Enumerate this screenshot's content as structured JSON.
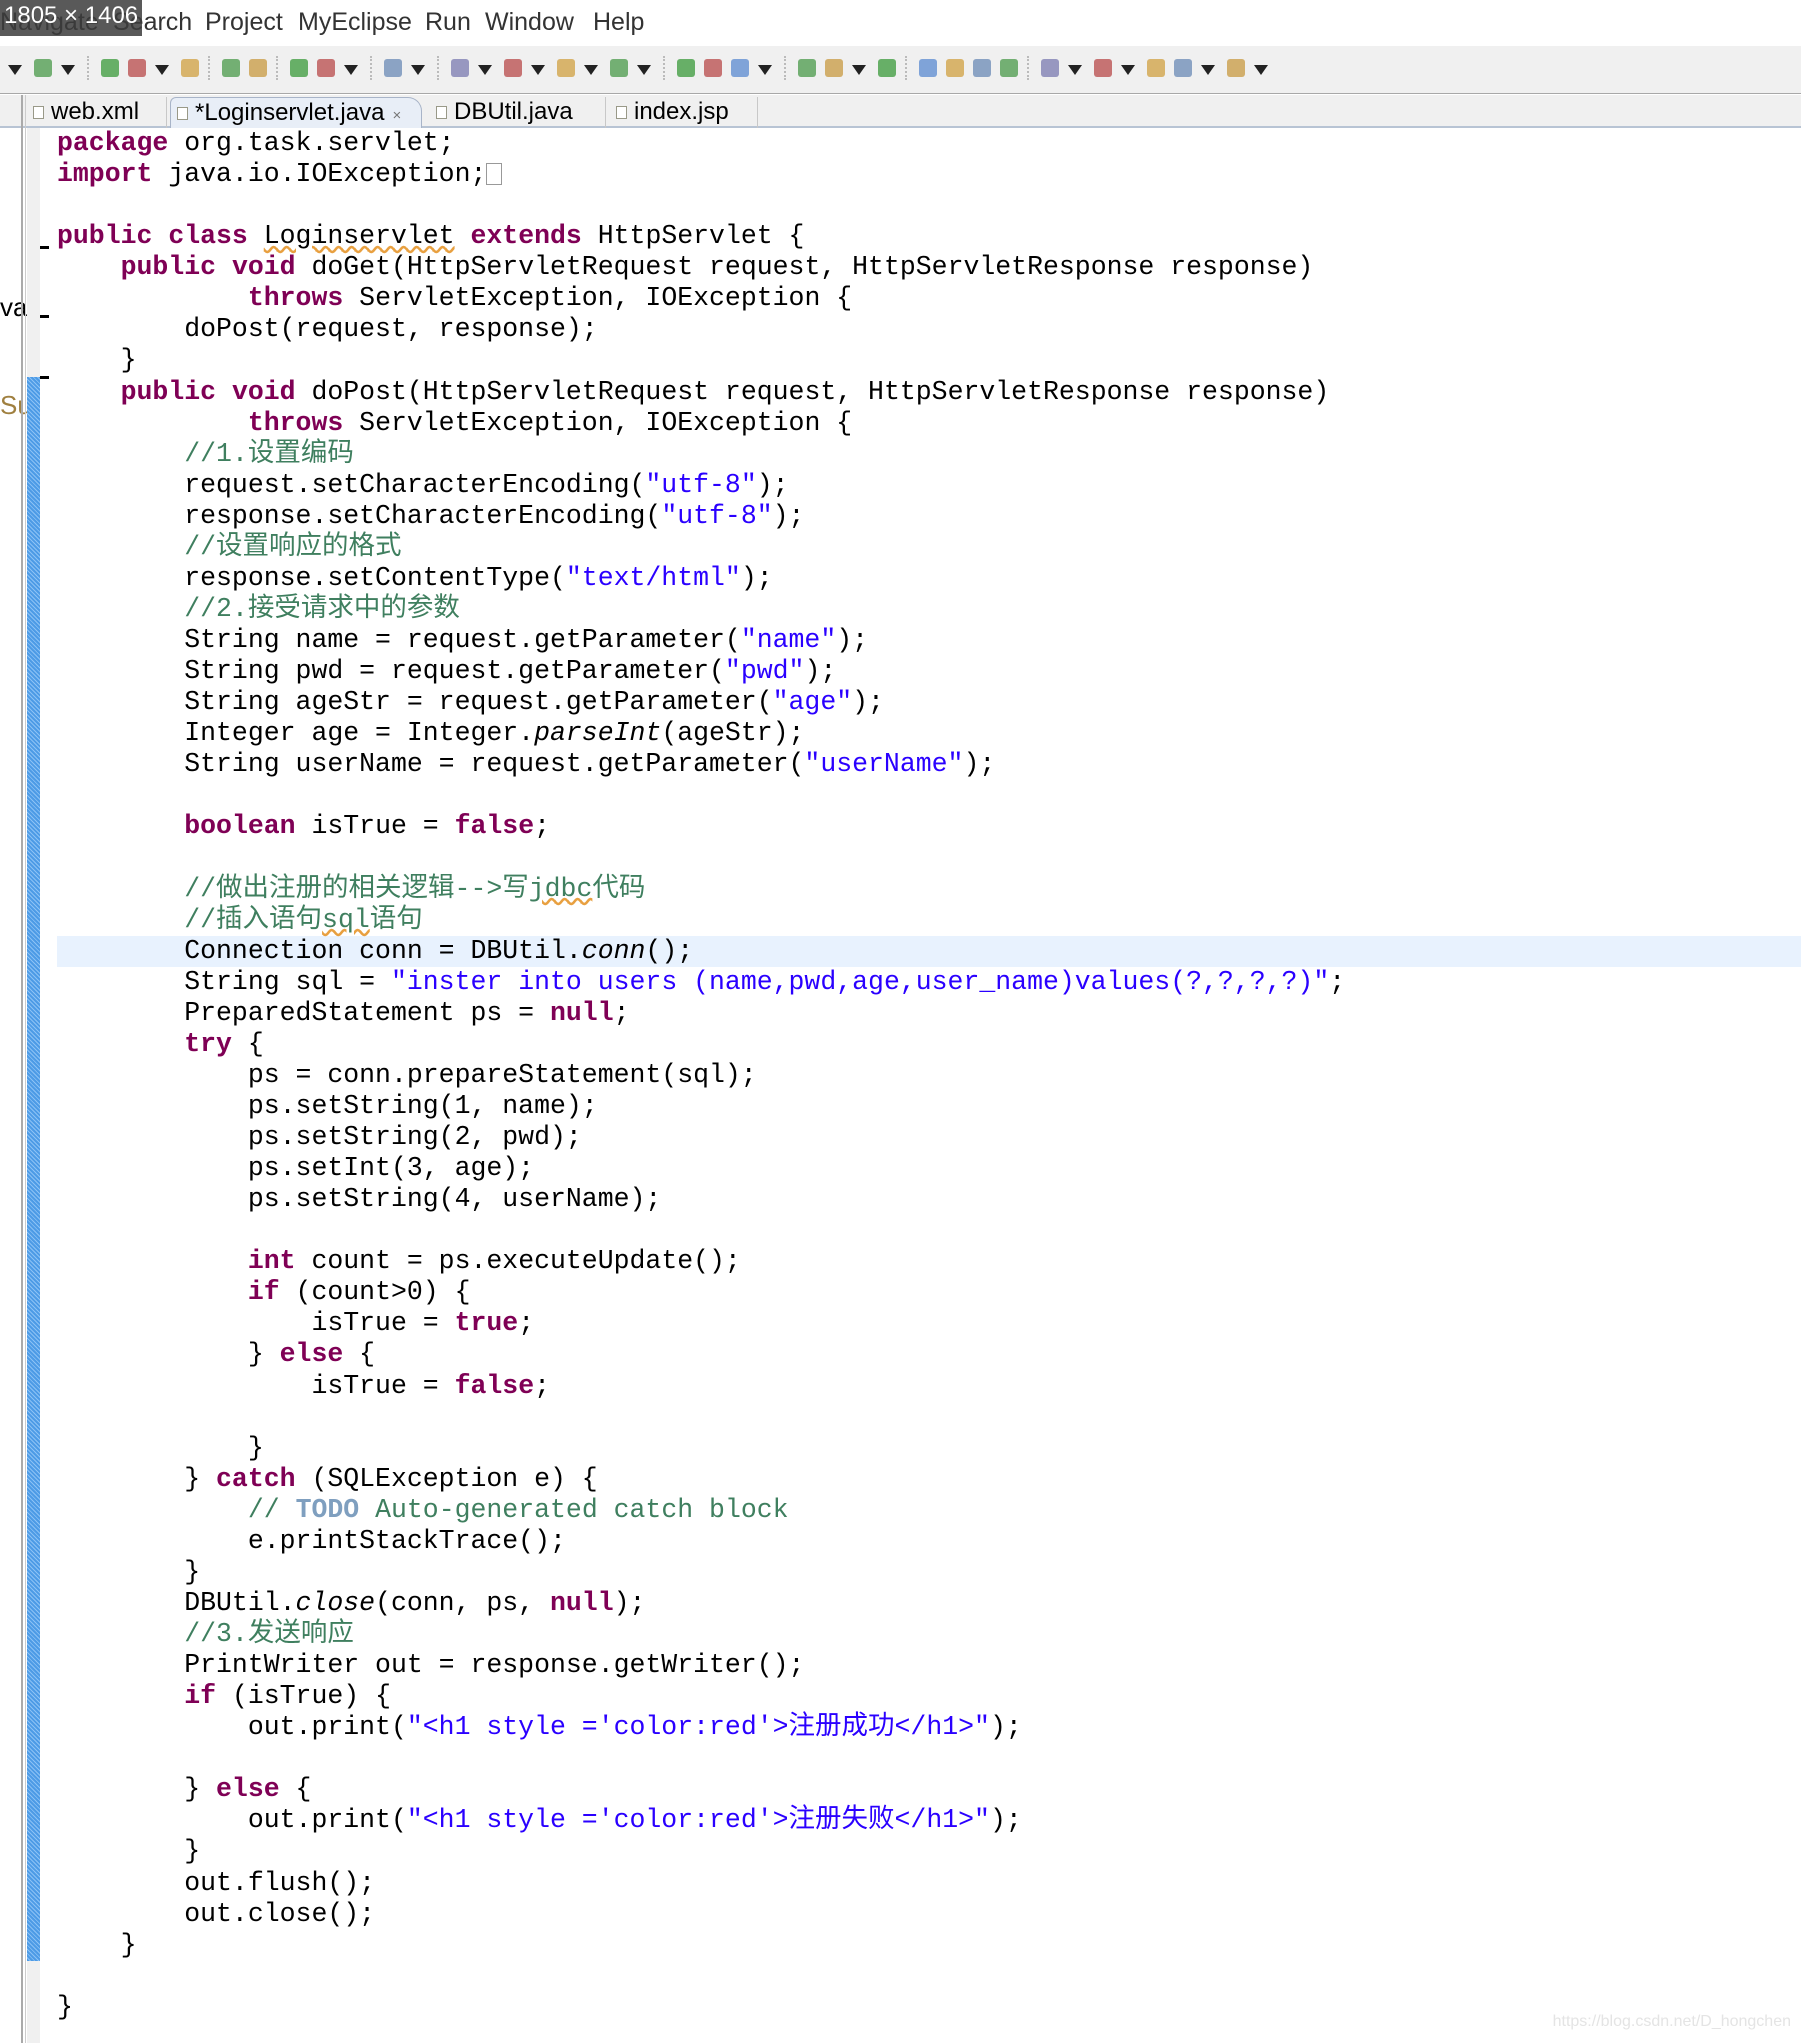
{
  "overlay": {
    "dimensions": "1805 × 1406"
  },
  "menu": [
    "Navigate",
    "Search",
    "Project",
    "MyEclipse",
    "Run",
    "Window",
    "Help"
  ],
  "tabs": [
    {
      "label": "web.xml",
      "active": false
    },
    {
      "label": "*Loginservlet.java",
      "active": true,
      "close": "×"
    },
    {
      "label": "DBUtil.java",
      "active": false
    },
    {
      "label": "index.jsp",
      "active": false
    }
  ],
  "side_fragments": [
    "va",
    "Su"
  ],
  "current_line": 26,
  "code": [
    [
      [
        "k",
        "package"
      ],
      [
        "p",
        " org.task.servlet;"
      ]
    ],
    [
      [
        "k",
        "import"
      ],
      [
        "p",
        " java.io.IOException;"
      ],
      [
        "box",
        ""
      ]
    ],
    [],
    [
      [
        "k",
        "public class"
      ],
      [
        "p",
        " "
      ],
      [
        "w",
        "Loginservlet"
      ],
      [
        "p",
        " "
      ],
      [
        "k",
        "extends"
      ],
      [
        "p",
        " HttpServlet {"
      ]
    ],
    [
      [
        "p",
        "    "
      ],
      [
        "k",
        "public void"
      ],
      [
        "p",
        " doGet(HttpServletRequest request, HttpServletResponse response)"
      ]
    ],
    [
      [
        "p",
        "            "
      ],
      [
        "k",
        "throws"
      ],
      [
        "p",
        " ServletException, IOException {"
      ]
    ],
    [
      [
        "p",
        "        doPost(request, response);"
      ]
    ],
    [
      [
        "p",
        "    }"
      ]
    ],
    [
      [
        "p",
        "    "
      ],
      [
        "k",
        "public void"
      ],
      [
        "p",
        " doPost(HttpServletRequest request, HttpServletResponse response)"
      ]
    ],
    [
      [
        "p",
        "            "
      ],
      [
        "k",
        "throws"
      ],
      [
        "p",
        " ServletException, IOException {"
      ]
    ],
    [
      [
        "p",
        "        "
      ],
      [
        "c",
        "//1.设置编码"
      ]
    ],
    [
      [
        "p",
        "        request.setCharacterEncoding("
      ],
      [
        "s",
        "\"utf-8\""
      ],
      [
        "p",
        ");"
      ]
    ],
    [
      [
        "p",
        "        response.setCharacterEncoding("
      ],
      [
        "s",
        "\"utf-8\""
      ],
      [
        "p",
        ");"
      ]
    ],
    [
      [
        "p",
        "        "
      ],
      [
        "c",
        "//设置响应的格式"
      ]
    ],
    [
      [
        "p",
        "        response.setContentType("
      ],
      [
        "s",
        "\"text/html\""
      ],
      [
        "p",
        ");"
      ]
    ],
    [
      [
        "p",
        "        "
      ],
      [
        "c",
        "//2.接受请求中的参数"
      ]
    ],
    [
      [
        "p",
        "        String name = request.getParameter("
      ],
      [
        "s",
        "\"name\""
      ],
      [
        "p",
        ");"
      ]
    ],
    [
      [
        "p",
        "        String pwd = request.getParameter("
      ],
      [
        "s",
        "\"pwd\""
      ],
      [
        "p",
        ");"
      ]
    ],
    [
      [
        "p",
        "        String ageStr = request.getParameter("
      ],
      [
        "s",
        "\"age\""
      ],
      [
        "p",
        ");"
      ]
    ],
    [
      [
        "p",
        "        Integer age = Integer."
      ],
      [
        "i",
        "parseInt"
      ],
      [
        "p",
        "(ageStr);"
      ]
    ],
    [
      [
        "p",
        "        String userName = request.getParameter("
      ],
      [
        "s",
        "\"userName\""
      ],
      [
        "p",
        ");"
      ]
    ],
    [],
    [
      [
        "p",
        "        "
      ],
      [
        "k",
        "boolean"
      ],
      [
        "p",
        " isTrue = "
      ],
      [
        "k",
        "false"
      ],
      [
        "p",
        ";"
      ]
    ],
    [],
    [
      [
        "p",
        "        "
      ],
      [
        "c",
        "//做出注册的相关逻辑-->写"
      ],
      [
        "cw",
        "jdbc"
      ],
      [
        "c",
        "代码"
      ]
    ],
    [
      [
        "p",
        "        "
      ],
      [
        "c",
        "//插入语句"
      ],
      [
        "cw",
        "sql"
      ],
      [
        "c",
        "语句"
      ]
    ],
    [
      [
        "p",
        "        Connection conn = DBUtil."
      ],
      [
        "i",
        "conn"
      ],
      [
        "p",
        "();"
      ]
    ],
    [
      [
        "p",
        "        String sql = "
      ],
      [
        "s",
        "\"inster into users (name,pwd,age,user_name)values(?,?,?,?)\""
      ],
      [
        "p",
        ";"
      ]
    ],
    [
      [
        "p",
        "        PreparedStatement ps = "
      ],
      [
        "k",
        "null"
      ],
      [
        "p",
        ";"
      ]
    ],
    [
      [
        "p",
        "        "
      ],
      [
        "k",
        "try"
      ],
      [
        "p",
        " {"
      ]
    ],
    [
      [
        "p",
        "            ps = conn.prepareStatement(sql);"
      ]
    ],
    [
      [
        "p",
        "            ps.setString(1, name);"
      ]
    ],
    [
      [
        "p",
        "            ps.setString(2, pwd);"
      ]
    ],
    [
      [
        "p",
        "            ps.setInt(3, age);"
      ]
    ],
    [
      [
        "p",
        "            ps.setString(4, userName);"
      ]
    ],
    [],
    [
      [
        "p",
        "            "
      ],
      [
        "k",
        "int"
      ],
      [
        "p",
        " count = ps.executeUpdate();"
      ]
    ],
    [
      [
        "p",
        "            "
      ],
      [
        "k",
        "if"
      ],
      [
        "p",
        " (count>0) {"
      ]
    ],
    [
      [
        "p",
        "                isTrue = "
      ],
      [
        "k",
        "true"
      ],
      [
        "p",
        ";"
      ]
    ],
    [
      [
        "p",
        "            } "
      ],
      [
        "k",
        "else"
      ],
      [
        "p",
        " {"
      ]
    ],
    [
      [
        "p",
        "                isTrue = "
      ],
      [
        "k",
        "false"
      ],
      [
        "p",
        ";"
      ]
    ],
    [],
    [
      [
        "p",
        "            }"
      ]
    ],
    [
      [
        "p",
        "        } "
      ],
      [
        "k",
        "catch"
      ],
      [
        "p",
        " (SQLException e) {"
      ]
    ],
    [
      [
        "p",
        "            "
      ],
      [
        "c",
        "// "
      ],
      [
        "t",
        "TODO"
      ],
      [
        "c",
        " Auto-generated catch block"
      ]
    ],
    [
      [
        "p",
        "            e.printStackTrace();"
      ]
    ],
    [
      [
        "p",
        "        }"
      ]
    ],
    [
      [
        "p",
        "        DBUtil."
      ],
      [
        "i",
        "close"
      ],
      [
        "p",
        "(conn, ps, "
      ],
      [
        "k",
        "null"
      ],
      [
        "p",
        ");"
      ]
    ],
    [
      [
        "p",
        "        "
      ],
      [
        "c",
        "//3.发送响应"
      ]
    ],
    [
      [
        "p",
        "        PrintWriter out = response.getWriter();"
      ]
    ],
    [
      [
        "p",
        "        "
      ],
      [
        "k",
        "if"
      ],
      [
        "p",
        " (isTrue) {"
      ]
    ],
    [
      [
        "p",
        "            out.print("
      ],
      [
        "s",
        "\"<h1 style ='color:red'>注册成功</h1>\""
      ],
      [
        "p",
        ");"
      ]
    ],
    [],
    [
      [
        "p",
        "        } "
      ],
      [
        "k",
        "else"
      ],
      [
        "p",
        " {"
      ]
    ],
    [
      [
        "p",
        "            out.print("
      ],
      [
        "s",
        "\"<h1 style ='color:red'>注册失败</h1>\""
      ],
      [
        "p",
        ");"
      ]
    ],
    [
      [
        "p",
        "        }"
      ]
    ],
    [
      [
        "p",
        "        out.flush();"
      ]
    ],
    [
      [
        "p",
        "        out.close();"
      ]
    ],
    [
      [
        "p",
        "    }"
      ]
    ],
    [],
    [
      [
        "p",
        "}"
      ]
    ]
  ],
  "watermark": "https://blog.csdn.net/D_hongchen",
  "colors": {
    "keyword": "#7f0055",
    "string": "#2a00ff",
    "comment": "#3f7f5f",
    "current_line": "#e8f2fe",
    "change_bar": "#4d9be6"
  }
}
